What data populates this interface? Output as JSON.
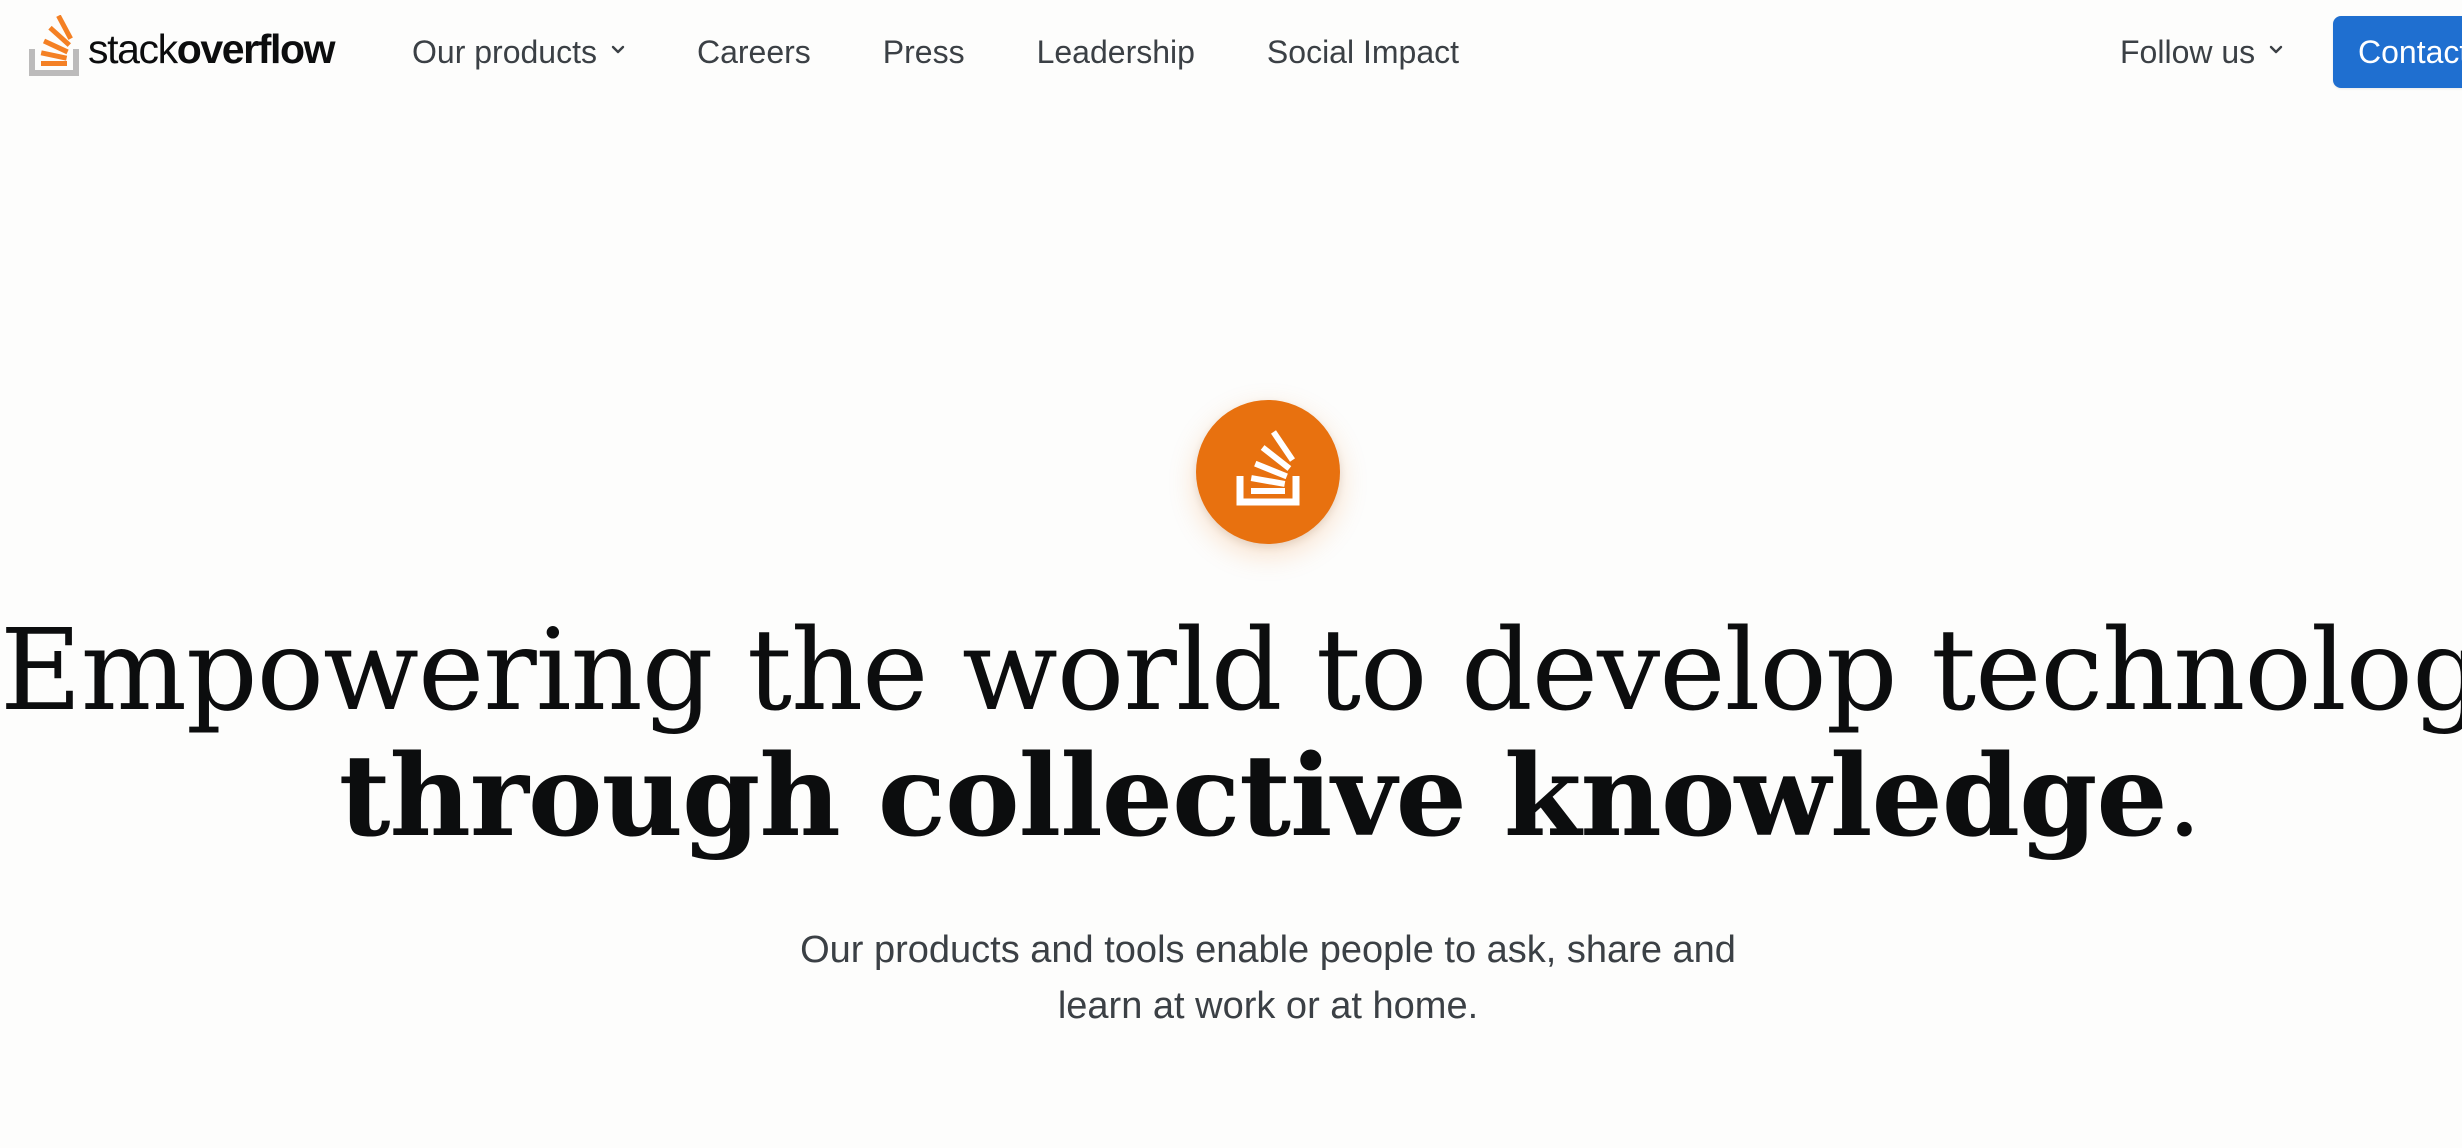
{
  "colors": {
    "accent_orange": "#e8710f",
    "button_blue": "#1f6fd0",
    "heading": "#0c0d0e",
    "body_text": "#3b4045",
    "background": "#fdfdfc"
  },
  "header": {
    "logo": {
      "icon": "stackoverflow-logo-icon",
      "word_light": "stack",
      "word_bold": "overflow"
    },
    "nav": [
      {
        "label": "Our products",
        "has_dropdown": true
      },
      {
        "label": "Careers"
      },
      {
        "label": "Press"
      },
      {
        "label": "Leadership"
      },
      {
        "label": "Social Impact"
      }
    ],
    "follow": {
      "label": "Follow us",
      "has_dropdown": true
    },
    "contact_label": "Contact"
  },
  "hero": {
    "badge_icon": "stackoverflow-mark-icon",
    "headline_regular": "Empowering the world to develop technology",
    "headline_bold": "through collective knowledge",
    "headline_end": ".",
    "subtext": "Our products and tools enable people to ask, share and learn at work or at home."
  }
}
